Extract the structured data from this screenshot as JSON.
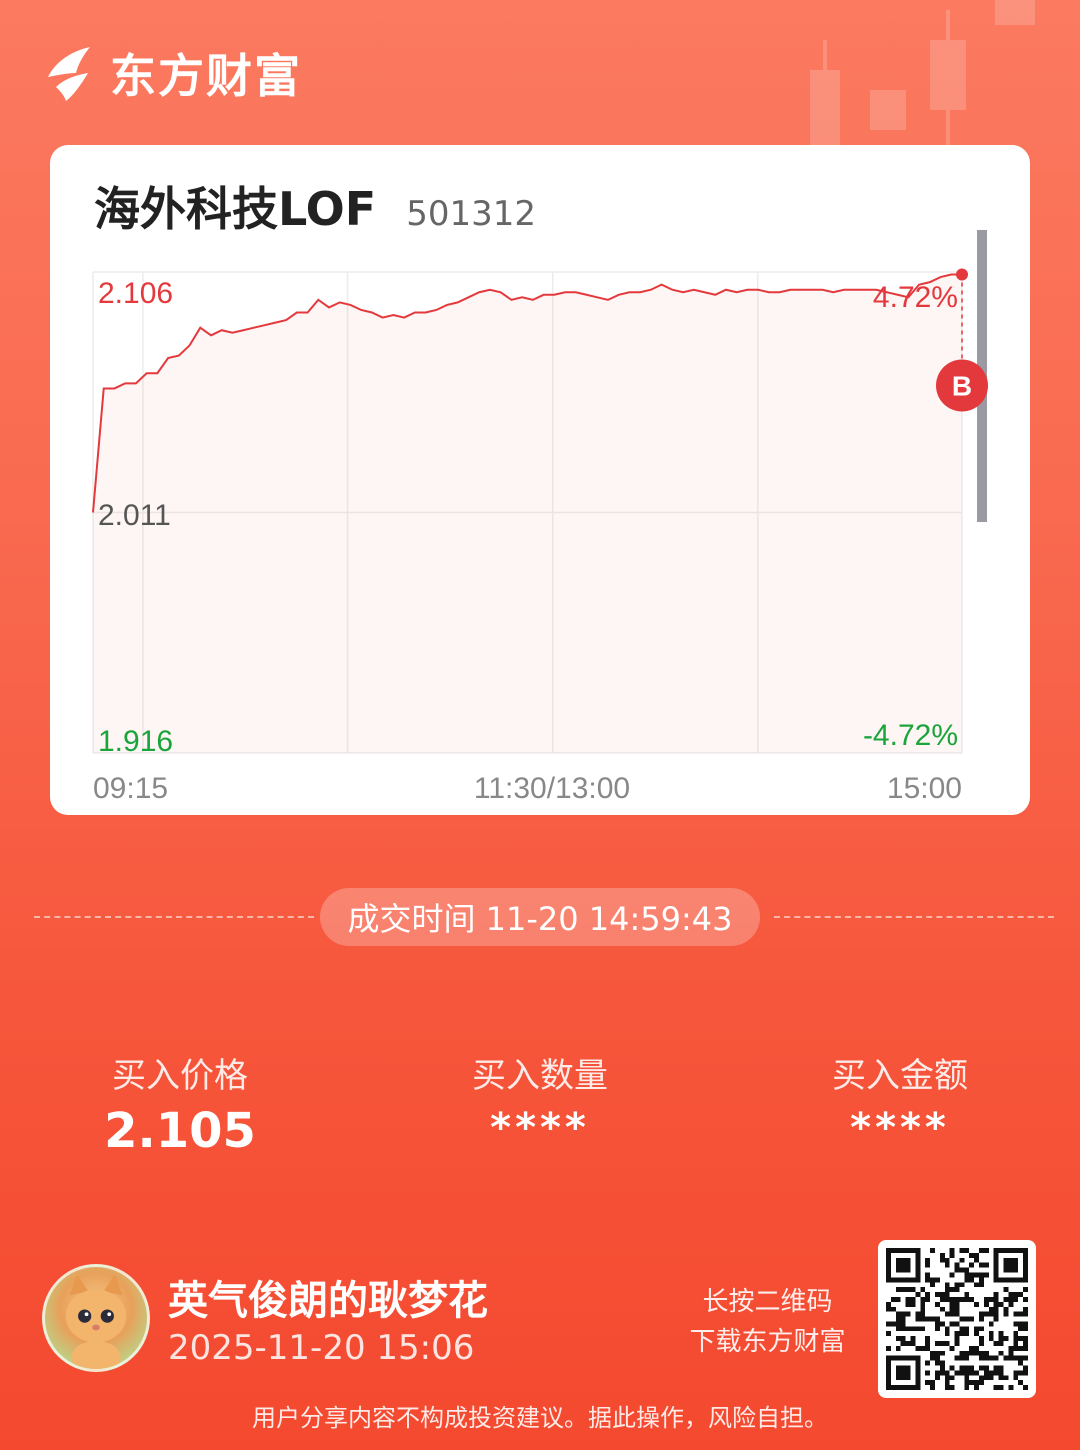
{
  "app": {
    "brand_name": "东方财富"
  },
  "fund": {
    "name": "海外科技LOF",
    "code": "501312"
  },
  "chart_data": {
    "type": "line",
    "title": "",
    "x_ticks": [
      "09:15",
      "11:30/13:00",
      "15:00"
    ],
    "y_ticks": {
      "high": "2.106",
      "mid": "2.011",
      "low": "1.916"
    },
    "pct_ticks": {
      "high": "4.72%",
      "low": "-4.72%"
    },
    "ylim": [
      1.916,
      2.106
    ],
    "reference_price": 2.011,
    "marker": {
      "label": "B",
      "price": 2.105,
      "at": "end"
    },
    "series": [
      {
        "values": [
          2.011,
          2.06,
          2.06,
          2.062,
          2.062,
          2.066,
          2.066,
          2.072,
          2.073,
          2.077,
          2.084,
          2.081,
          2.083,
          2.082,
          2.083,
          2.084,
          2.085,
          2.086,
          2.087,
          2.09,
          2.09,
          2.095,
          2.092,
          2.094,
          2.093,
          2.091,
          2.09,
          2.088,
          2.089,
          2.088,
          2.09,
          2.09,
          2.091,
          2.093,
          2.094,
          2.096,
          2.098,
          2.099,
          2.098,
          2.095,
          2.096,
          2.095,
          2.097,
          2.097,
          2.098,
          2.098,
          2.097,
          2.096,
          2.095,
          2.097,
          2.098,
          2.098,
          2.099,
          2.101,
          2.099,
          2.098,
          2.099,
          2.098,
          2.097,
          2.099,
          2.098,
          2.099,
          2.099,
          2.098,
          2.098,
          2.099,
          2.099,
          2.099,
          2.099,
          2.098,
          2.099,
          2.099,
          2.099,
          2.099,
          2.098,
          2.097,
          2.096,
          2.101,
          2.102,
          2.104,
          2.105,
          2.105
        ]
      }
    ]
  },
  "trade": {
    "time_label": "成交时间 11-20 14:59:43",
    "price_label": "买入价格",
    "price_value": "2.105",
    "qty_label": "买入数量",
    "qty_value": "****",
    "amount_label": "买入金额",
    "amount_value": "****"
  },
  "user": {
    "nickname": "英气俊朗的耿梦花",
    "share_time": "2025-11-20 15:06"
  },
  "qr": {
    "hint_line1": "长按二维码",
    "hint_line2": "下载东方财富"
  },
  "footer": {
    "disclaimer": "用户分享内容不构成投资建议。据此操作，风险自担。"
  },
  "colors": {
    "up": "#e4393c",
    "down": "#1aa53b",
    "background": "#f7593d"
  }
}
